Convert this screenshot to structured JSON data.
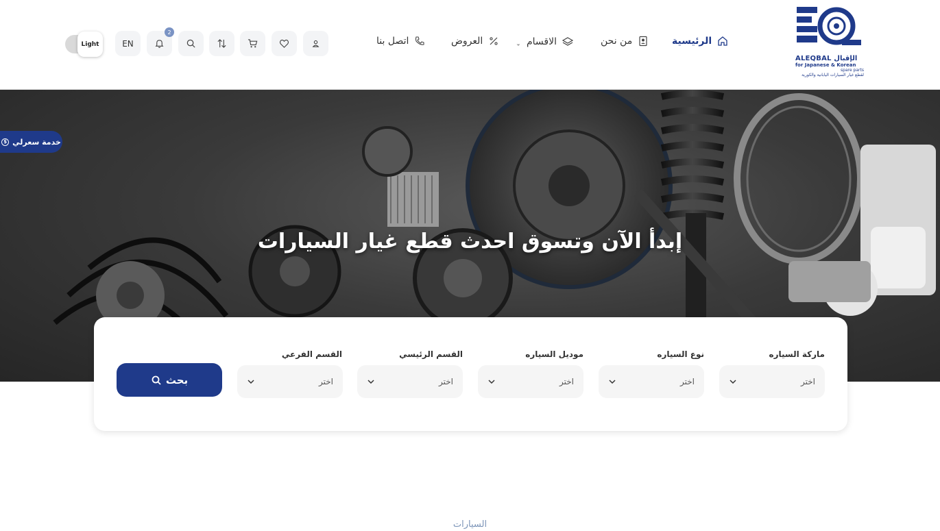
{
  "brand": {
    "name_en": "ALEQBAL",
    "name_ar": "الإقبال",
    "tagline_en": "for Japanese & Korean",
    "tagline_en2": "spare parts",
    "tagline_ar": "لقطع غيار السيارات اليابانية والكورية",
    "color": "#1f3a8a"
  },
  "nav": {
    "home": "الرئيسية",
    "about": "من نحن",
    "categories": "الاقسام",
    "offers": "العروض",
    "contact": "اتصل بنا"
  },
  "toolbar": {
    "notifications_count": "2",
    "language": "EN",
    "theme": "Light"
  },
  "side_tab": {
    "label": "خدمة سعرلي",
    "icon": "currency-icon"
  },
  "hero": {
    "title": "إبدأ الآن وتسوق احدث قطع غيار السيارات"
  },
  "search": {
    "fields": [
      {
        "label": "ماركة السياره",
        "value": "اختر"
      },
      {
        "label": "نوع السياره",
        "value": "اختر"
      },
      {
        "label": "موديل السياره",
        "value": "اختر"
      },
      {
        "label": "القسم الرئيسي",
        "value": "اختر"
      },
      {
        "label": "القسم الفرعي",
        "value": "اختر"
      }
    ],
    "button": "بحث"
  },
  "section": {
    "title": "السيارات"
  }
}
